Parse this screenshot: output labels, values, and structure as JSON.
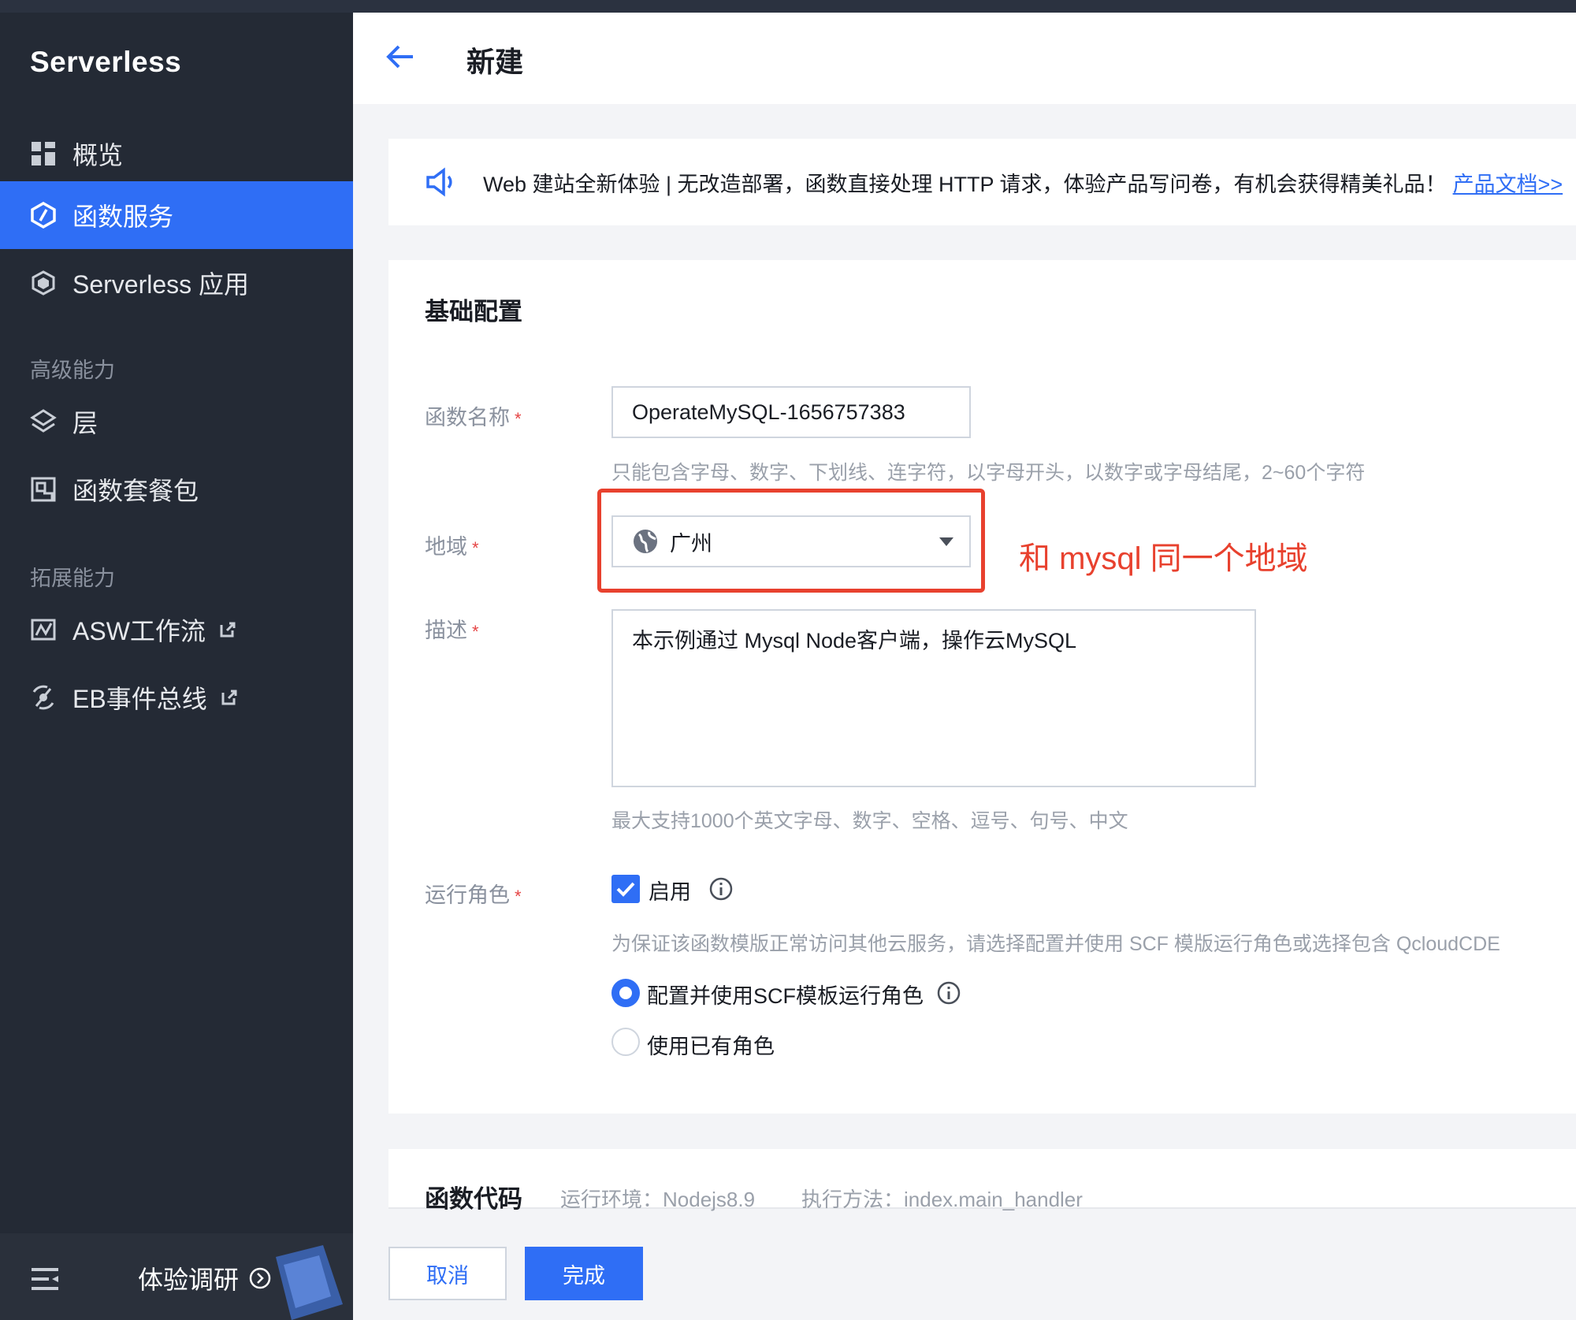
{
  "sidebar": {
    "brand": "Serverless",
    "items": [
      {
        "label": "概览",
        "icon": "grid-icon"
      },
      {
        "label": "函数服务",
        "icon": "function-icon",
        "active": true
      },
      {
        "label": "Serverless 应用",
        "icon": "app-cube-icon"
      }
    ],
    "section_advanced": "高级能力",
    "advanced_items": [
      {
        "label": "层",
        "icon": "layers-icon"
      },
      {
        "label": "函数套餐包",
        "icon": "package-icon"
      }
    ],
    "section_extend": "拓展能力",
    "extend_items": [
      {
        "label": "ASW工作流",
        "icon": "workflow-icon"
      },
      {
        "label": "EB事件总线",
        "icon": "event-bus-icon"
      }
    ],
    "footer_survey": "体验调研"
  },
  "header": {
    "title": "新建"
  },
  "notice": {
    "text": "Web 建站全新体验 | 无改造部署，函数直接处理 HTTP 请求，体验产品写问卷，有机会获得精美礼品！",
    "link": "产品文档>>"
  },
  "basic_config": {
    "title": "基础配置",
    "function_name_label": "函数名称",
    "function_name_value": "OperateMySQL-1656757383",
    "function_name_hint": "只能包含字母、数字、下划线、连字符，以字母开头，以数字或字母结尾，2~60个字符",
    "region_label": "地域",
    "region_value": "广州",
    "region_annotation": "和 mysql 同一个地域",
    "description_label": "描述",
    "description_value": "本示例通过 Mysql Node客户端，操作云MySQL",
    "description_hint": "最大支持1000个英文字母、数字、空格、逗号、句号、中文",
    "role_label": "运行角色",
    "role_enable_label": "启用",
    "role_hint": "为保证该函数模版正常访问其他云服务，请选择配置并使用 SCF 模版运行角色或选择包含 QcloudCDE",
    "role_option_1": "配置并使用SCF模板运行角色",
    "role_option_2": "使用已有角色"
  },
  "code_section": {
    "title": "函数代码",
    "runtime": "运行环境：Nodejs8.9",
    "handler": "执行方法：index.main_handler"
  },
  "buttons": {
    "cancel": "取消",
    "done": "完成"
  },
  "colors": {
    "primary": "#2f6ef5",
    "sidebar": "#242a35",
    "annotation": "#e8412e"
  }
}
